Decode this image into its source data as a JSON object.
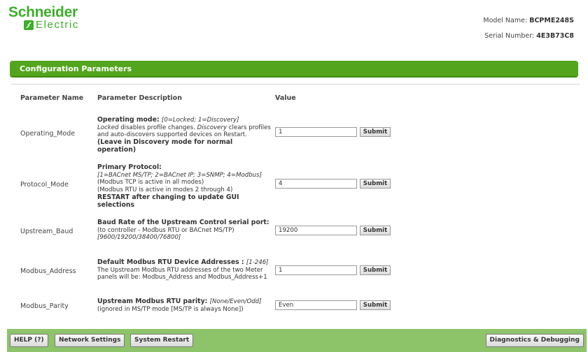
{
  "brand": {
    "line1": "Schneider",
    "line2": "Electric",
    "color": "#3dae2b"
  },
  "device": {
    "model_label": "Model Name:",
    "model_value": "BCPME248S",
    "serial_label": "Serial Number:",
    "serial_value": "4E3B73C8"
  },
  "section": {
    "title": "Configuration Parameters",
    "color": "#53a51e"
  },
  "columns": {
    "name": "Parameter Name",
    "description": "Parameter Description",
    "value": "Value"
  },
  "submit_label": "Submit",
  "rows": [
    {
      "name": "Operating_Mode",
      "title": "Operating mode: ",
      "range": "[0=Locked; 1=Discovery]",
      "d1_em": "Locked",
      "d1_rest": " disables profile changes. ",
      "d1_em2": "Discovery",
      "d1_rest2": " clears profiles and auto-discovers supported devices on Restart.",
      "note": "(Leave in Discovery mode for normal operation)",
      "value": "1"
    },
    {
      "name": "Protocol_Mode",
      "title": "Primary Protocol:",
      "range": "[1=BACnet MS/TP; 2=BACnet IP; 3=SNMP; 4=Modbus]",
      "l1": "(Modbus TCP is active in all modes)",
      "l2": "(Modbus RTU is active in modes 2 through 4)",
      "note": "RESTART after changing to update GUI selections",
      "value": "4"
    },
    {
      "name": "Upstream_Baud",
      "title": "Baud Rate of the Upstream Control serial port:",
      "l1": "(to controller - Modbus RTU or BACnet MS/TP)",
      "range": "[9600/19200/38400/76800]",
      "value": "19200"
    },
    {
      "name": "Modbus_Address",
      "title": "Default Modbus RTU Device Addresses : ",
      "range": "[1-246]",
      "l1": "The Upstream Modbus RTU addresses of the two Meter panels will be: Modbus_Address and Modbus_Address+1",
      "value": "1"
    },
    {
      "name": "Modbus_Parity",
      "title": "Upstream Modbus RTU parity: ",
      "range": "[None/Even/Odd]",
      "l1": "(ignored in MS/TP mode [MS/TP is always None])",
      "value": "Even"
    }
  ],
  "footer": {
    "help": "HELP (?)",
    "network": "Network Settings",
    "restart": "System Restart",
    "diagnostics": "Diagnostics & Debugging",
    "color": "#8dc46a"
  }
}
